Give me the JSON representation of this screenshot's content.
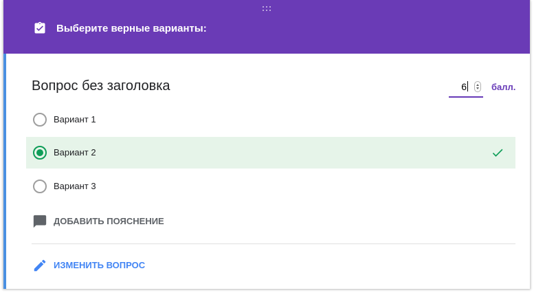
{
  "header": {
    "title": "Выберите верные варианты:",
    "icon": "clipboard-check-icon",
    "color": "#6a3bb6"
  },
  "question": {
    "title": "Вопрос без заголовка",
    "points_value": "6",
    "points_label": "балл."
  },
  "options": [
    {
      "label": "Вариант 1",
      "selected": false,
      "correct": false
    },
    {
      "label": "Вариант 2",
      "selected": true,
      "correct": true
    },
    {
      "label": "Вариант 3",
      "selected": false,
      "correct": false
    }
  ],
  "actions": {
    "add_feedback": "ДОБАВИТЬ ПОЯСНЕНИЕ",
    "edit_question": "ИЗМЕНИТЬ ВОПРОС"
  },
  "colors": {
    "accent": "#673ab7",
    "correct_green": "#0f9d58",
    "correct_bg": "#e6f4e9",
    "link_blue": "#4285f4"
  }
}
